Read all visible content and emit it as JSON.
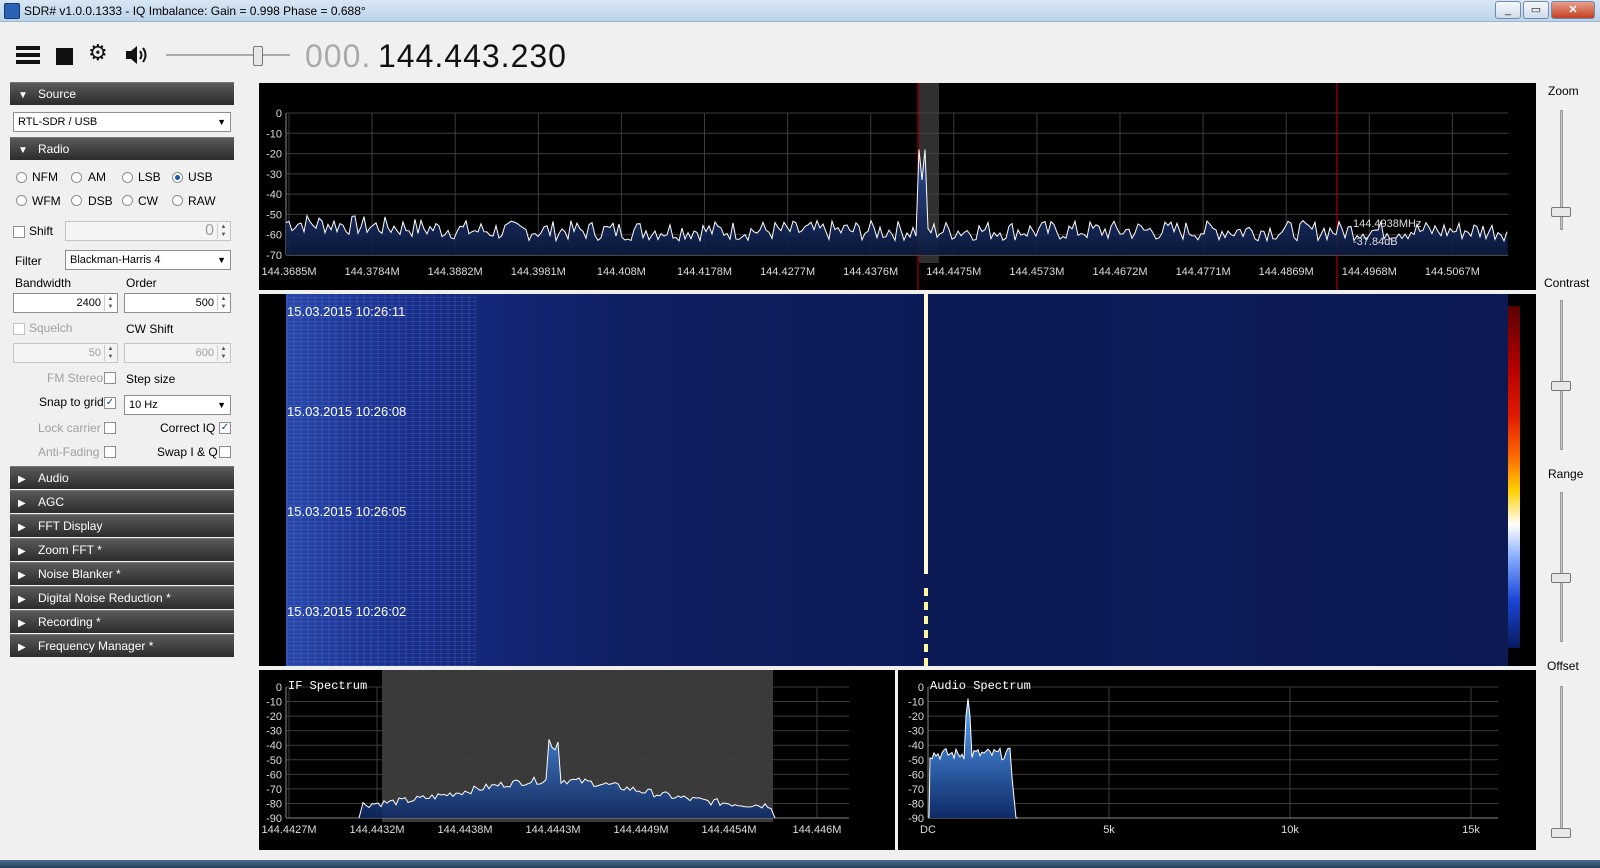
{
  "window": {
    "title": "SDR# v1.0.0.1333 - IQ Imbalance: Gain = 0.998 Phase = 0.688°",
    "controls": {
      "minimize": "_",
      "maximize": "▭",
      "close": "✕"
    }
  },
  "toolbar": {
    "icons": [
      "menu-icon",
      "stop-icon",
      "gear-icon",
      "speaker-icon"
    ],
    "frequency_prefix": "000.",
    "frequency_main": "144.443.230",
    "volume_level": 0.74
  },
  "source": {
    "header": "Source",
    "device": "RTL-SDR / USB"
  },
  "radio": {
    "header": "Radio",
    "modes": [
      {
        "label": "NFM",
        "selected": false
      },
      {
        "label": "AM",
        "selected": false
      },
      {
        "label": "LSB",
        "selected": false
      },
      {
        "label": "USB",
        "selected": true
      },
      {
        "label": "WFM",
        "selected": false
      },
      {
        "label": "DSB",
        "selected": false
      },
      {
        "label": "CW",
        "selected": false
      },
      {
        "label": "RAW",
        "selected": false
      }
    ],
    "shift_label": "Shift",
    "shift_value": "0",
    "filter_label": "Filter",
    "filter_value": "Blackman-Harris 4",
    "bandwidth_label": "Bandwidth",
    "bandwidth_value": "2400",
    "order_label": "Order",
    "order_value": "500",
    "squelch_label": "Squelch",
    "squelch_value": "50",
    "cw_shift_label": "CW Shift",
    "cw_shift_value": "600",
    "fm_stereo_label": "FM Stereo",
    "step_size_label": "Step size",
    "snap_label": "Snap to grid",
    "step_value": "10 Hz",
    "lock_carrier_label": "Lock carrier",
    "correct_iq_label": "Correct IQ",
    "anti_fading_label": "Anti-Fading",
    "swap_iq_label": "Swap I & Q",
    "checks": {
      "shift": false,
      "snap": true,
      "correct_iq": true,
      "fm_stereo": false,
      "lock_carrier": false,
      "anti_fading": false,
      "swap_iq": false,
      "squelch": false
    }
  },
  "panels": [
    "Audio",
    "AGC",
    "FFT Display",
    "Zoom FFT *",
    "Noise Blanker *",
    "Digital Noise Reduction *",
    "Recording *",
    "Frequency Manager *"
  ],
  "spectrum": {
    "db_ticks": [
      "0",
      "-10",
      "-20",
      "-30",
      "-40",
      "-50",
      "-60",
      "-70"
    ],
    "freq_ticks": [
      "144.3685M",
      "144.3784M",
      "144.3882M",
      "144.3981M",
      "144.408M",
      "144.4178M",
      "144.4277M",
      "144.4376M",
      "144.4475M",
      "144.4573M",
      "144.4672M",
      "144.4771M",
      "144.4869M",
      "144.4968M",
      "144.5067M"
    ],
    "cursor_freq": "144.4938MHz",
    "cursor_level": "-37.84dB"
  },
  "waterfall": {
    "timestamps": [
      "15.03.2015 10:26:11",
      "15.03.2015 10:26:08",
      "15.03.2015 10:26:05",
      "15.03.2015 10:26:02"
    ]
  },
  "if_spectrum": {
    "title": "IF Spectrum",
    "db_ticks": [
      "0",
      "-10",
      "-20",
      "-30",
      "-40",
      "-50",
      "-60",
      "-70",
      "-80",
      "-90"
    ],
    "freq_ticks": [
      "144.4427M",
      "144.4432M",
      "144.4438M",
      "144.4443M",
      "144.4449M",
      "144.4454M",
      "144.446M"
    ]
  },
  "audio_spectrum": {
    "title": "Audio Spectrum",
    "db_ticks": [
      "0",
      "-10",
      "-20",
      "-30",
      "-40",
      "-50",
      "-60",
      "-70",
      "-80",
      "-90"
    ],
    "freq_ticks": [
      "DC",
      "5k",
      "10k",
      "15k"
    ]
  },
  "right_sliders": {
    "zoom": "Zoom",
    "contrast": "Contrast",
    "range": "Range",
    "offset": "Offset"
  }
}
